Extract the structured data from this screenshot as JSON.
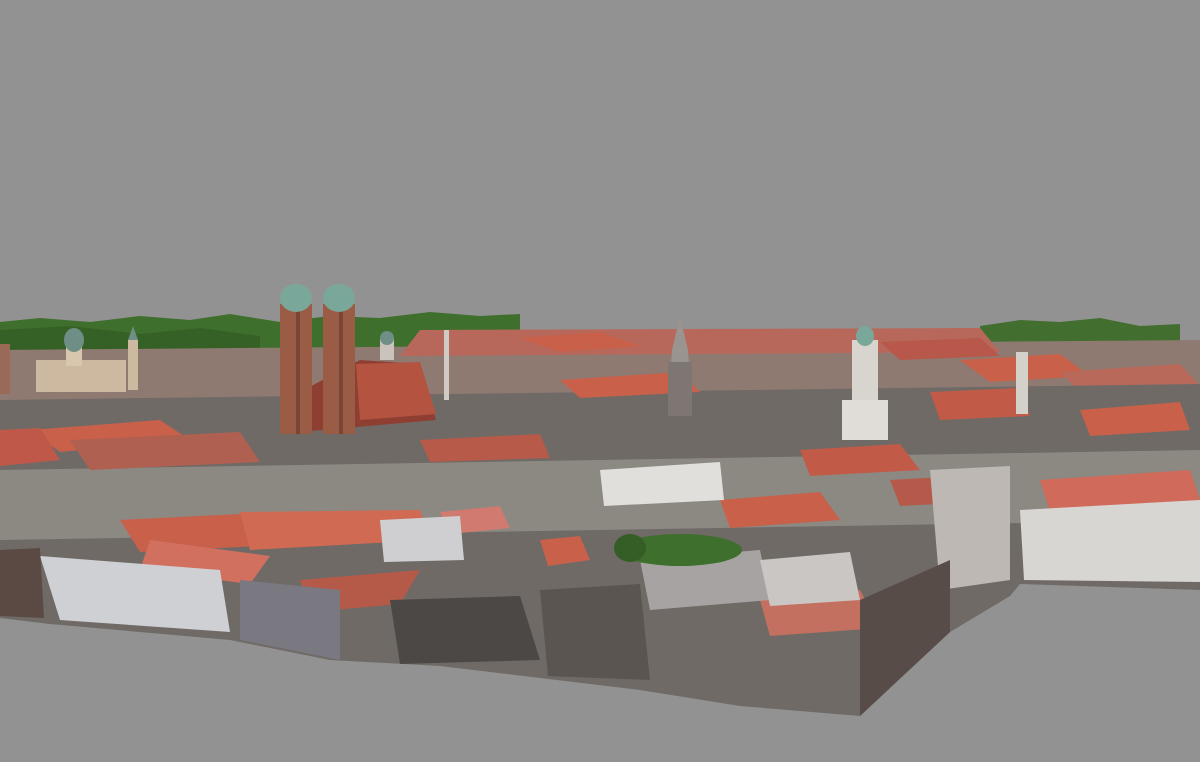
{
  "scene": {
    "background_color": "#929292",
    "palette": {
      "roof_red": "#c8604a",
      "roof_dark": "#8e3f32",
      "brick": "#9a5c45",
      "tower_copper": "#79a89a",
      "wall_light": "#d8d5cf",
      "wall_shadow": "#5a5550",
      "trees": "#3f6f2c"
    },
    "landmarks": [
      "twin-tower-church-with-copper-domes",
      "gothic-spire-tower",
      "white-church-tower",
      "baroque-domed-church"
    ]
  }
}
